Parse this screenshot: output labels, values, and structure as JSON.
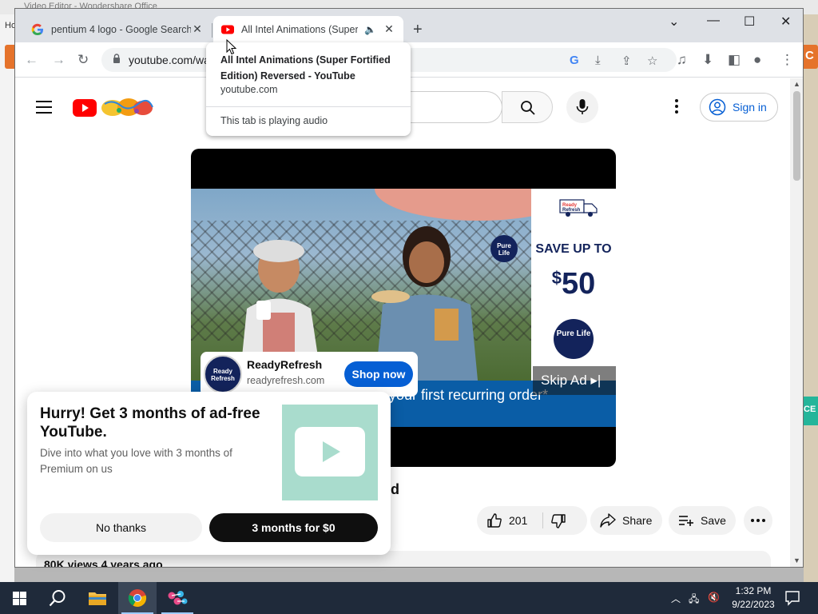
{
  "desktop": {
    "top_text": "Video Editor - Wondershare Office",
    "left_text": "Ho",
    "right_badge": "C",
    "right_teal": "CE"
  },
  "browser": {
    "tabs": [
      {
        "title": "pentium 4 logo - Google Search",
        "favicon": "google-g-icon",
        "active": false
      },
      {
        "title": "All Intel Animations (Super Fortified Edition) Reversed - YouTube",
        "favicon": "youtube-icon",
        "active": true,
        "audio": "speaker-icon"
      }
    ],
    "new_tab": "+",
    "url": "youtube.com/wa",
    "hover_card": {
      "title": "All Intel Animations (Super Fortified Edition) Reversed - YouTube",
      "domain": "youtube.com",
      "status": "This tab is playing audio"
    }
  },
  "youtube": {
    "sign_in": "Sign in",
    "ad": {
      "advertiser": "ReadyRefresh",
      "domain": "readyrefresh.com",
      "cta": "Shop now",
      "skip": "Skip Ad",
      "banner_text": "your first recurring order*",
      "side_save": "SAVE UP TO",
      "side_amount": "50",
      "side_currency": "$",
      "pure_life": "Pure Life",
      "ready_refresh_logo": "Ready Refresh"
    },
    "title_fragment": "d",
    "actions": {
      "likes": "201",
      "share": "Share",
      "save": "Save"
    },
    "meta": "80K views  4 years ago",
    "promo": {
      "heading": "Hurry! Get 3 months of ad-free YouTube.",
      "body": "Dive into what you love with 3 months of Premium on us",
      "decline": "No thanks",
      "accept": "3 months for $0"
    }
  },
  "taskbar": {
    "time": "1:32 PM",
    "date": "9/22/2023"
  },
  "colors": {
    "youtube_red": "#ff0000",
    "link_blue": "#065fd4",
    "ad_navy": "#13235b",
    "banner_blue": "#0a5da6",
    "promo_mint": "#a9dccd"
  }
}
